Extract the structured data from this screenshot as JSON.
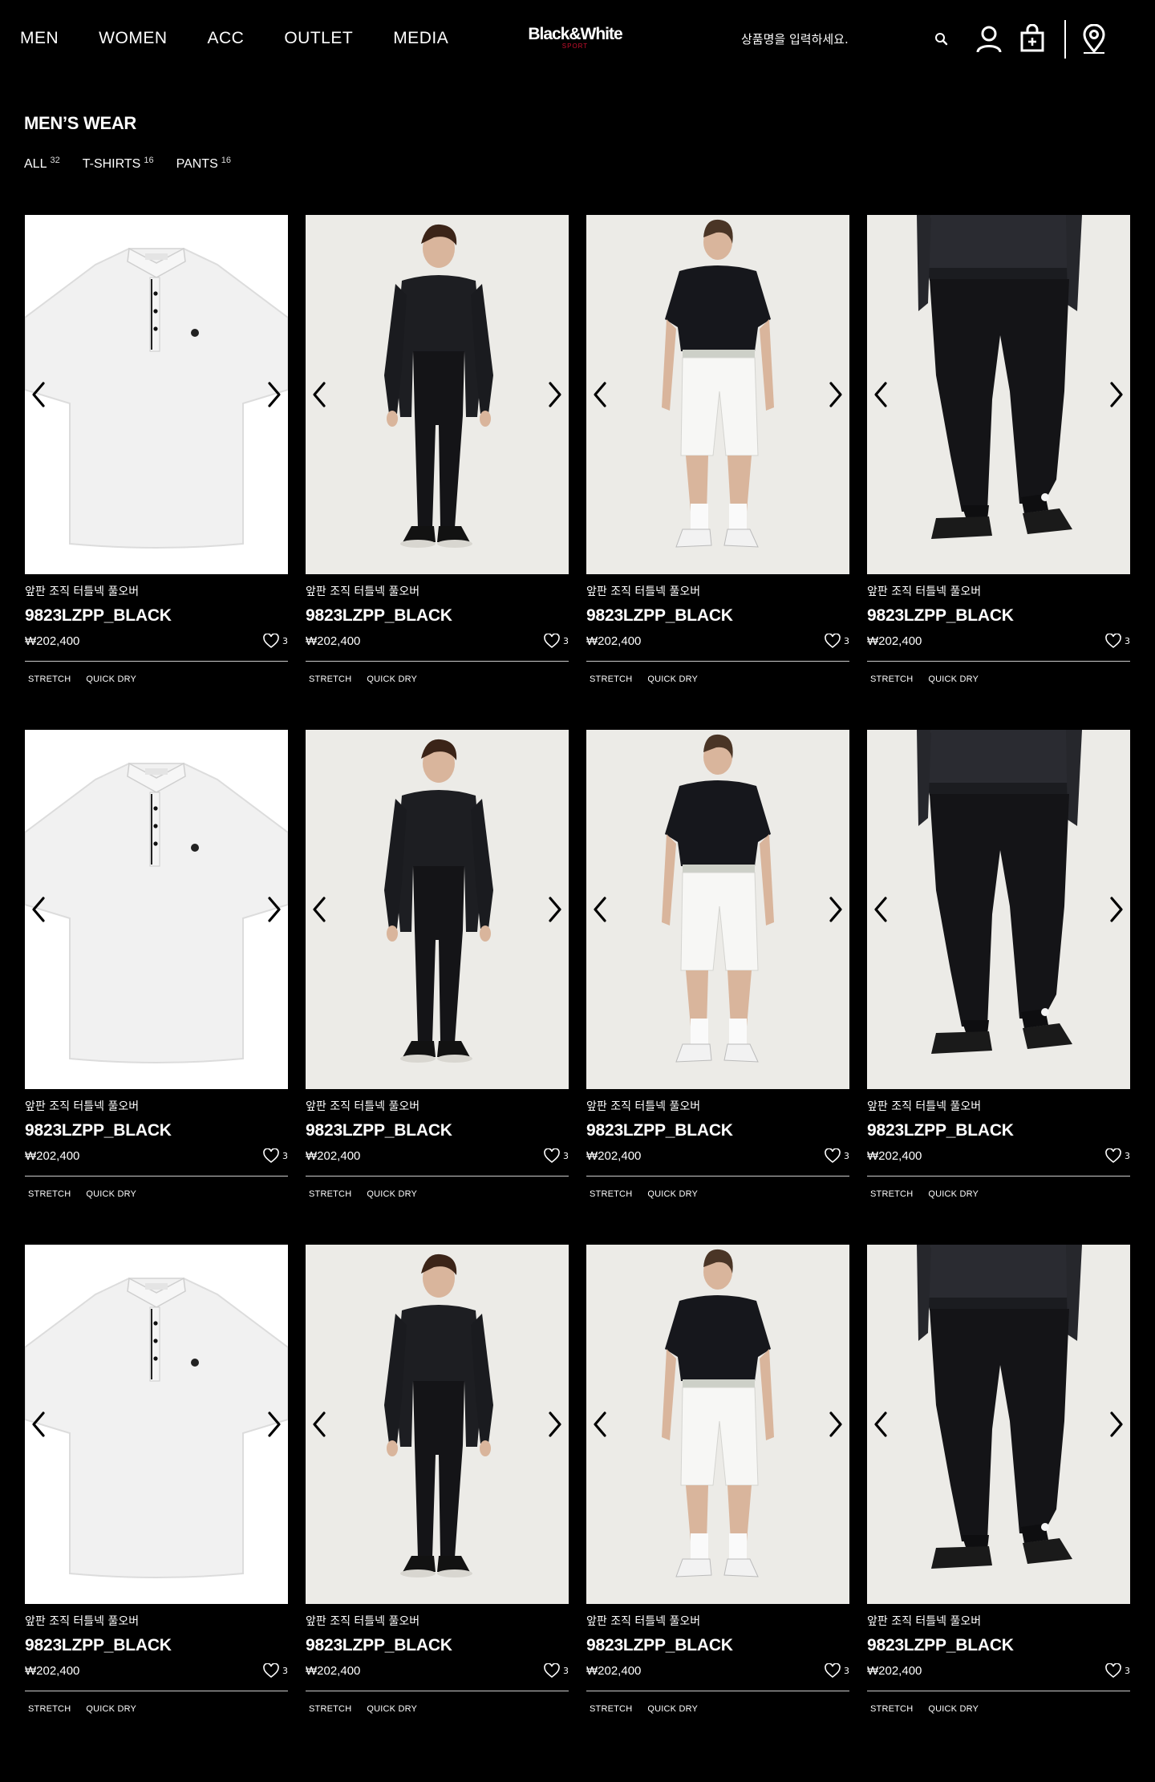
{
  "nav": [
    "MEN",
    "WOMEN",
    "ACC",
    "OUTLET",
    "MEDIA"
  ],
  "logo": {
    "main": "Black&White",
    "sub": "SPORT"
  },
  "search": {
    "placeholder": "상품명을 입력하세요."
  },
  "icons": [
    "search-icon",
    "user-icon",
    "shopping-bag-icon",
    "store-location-icon",
    "chevron-left-icon",
    "chevron-right-icon",
    "heart-icon"
  ],
  "colors": {
    "background": "#000000",
    "text": "#ffffff",
    "brand_accent": "#c8102e"
  },
  "page": {
    "title": "MEN’S WEAR",
    "filters": [
      {
        "label": "ALL",
        "count": "32"
      },
      {
        "label": "T-SHIRTS",
        "count": "16"
      },
      {
        "label": "PANTS",
        "count": "16"
      }
    ]
  },
  "products": [
    {
      "image": "white-polo-shirt",
      "subtitle": "앞판 조직 터틀넥 풀오버",
      "name": "9823LZPP_BLACK",
      "price": "₩202,400",
      "likes": "3",
      "tags": [
        "STRETCH",
        "QUICK DRY"
      ]
    },
    {
      "image": "model-black-longsleeve",
      "subtitle": "앞판 조직 터틀넥 풀오버",
      "name": "9823LZPP_BLACK",
      "price": "₩202,400",
      "likes": "3",
      "tags": [
        "STRETCH",
        "QUICK DRY"
      ]
    },
    {
      "image": "model-black-polo-white-shorts",
      "subtitle": "앞판 조직 터틀넥 풀오버",
      "name": "9823LZPP_BLACK",
      "price": "₩202,400",
      "likes": "3",
      "tags": [
        "STRETCH",
        "QUICK DRY"
      ]
    },
    {
      "image": "model-black-jogger-pants",
      "subtitle": "앞판 조직 터틀넥 풀오버",
      "name": "9823LZPP_BLACK",
      "price": "₩202,400",
      "likes": "3",
      "tags": [
        "STRETCH",
        "QUICK DRY"
      ]
    },
    {
      "image": "white-polo-shirt",
      "subtitle": "앞판 조직 터틀넥 풀오버",
      "name": "9823LZPP_BLACK",
      "price": "₩202,400",
      "likes": "3",
      "tags": [
        "STRETCH",
        "QUICK DRY"
      ]
    },
    {
      "image": "model-black-longsleeve",
      "subtitle": "앞판 조직 터틀넥 풀오버",
      "name": "9823LZPP_BLACK",
      "price": "₩202,400",
      "likes": "3",
      "tags": [
        "STRETCH",
        "QUICK DRY"
      ]
    },
    {
      "image": "model-black-polo-white-shorts",
      "subtitle": "앞판 조직 터틀넥 풀오버",
      "name": "9823LZPP_BLACK",
      "price": "₩202,400",
      "likes": "3",
      "tags": [
        "STRETCH",
        "QUICK DRY"
      ]
    },
    {
      "image": "model-black-jogger-pants",
      "subtitle": "앞판 조직 터틀넥 풀오버",
      "name": "9823LZPP_BLACK",
      "price": "₩202,400",
      "likes": "3",
      "tags": [
        "STRETCH",
        "QUICK DRY"
      ]
    },
    {
      "image": "white-polo-shirt",
      "subtitle": "앞판 조직 터틀넥 풀오버",
      "name": "9823LZPP_BLACK",
      "price": "₩202,400",
      "likes": "3",
      "tags": [
        "STRETCH",
        "QUICK DRY"
      ]
    },
    {
      "image": "model-black-longsleeve",
      "subtitle": "앞판 조직 터틀넥 풀오버",
      "name": "9823LZPP_BLACK",
      "price": "₩202,400",
      "likes": "3",
      "tags": [
        "STRETCH",
        "QUICK DRY"
      ]
    },
    {
      "image": "model-black-polo-white-shorts",
      "subtitle": "앞판 조직 터틀넥 풀오버",
      "name": "9823LZPP_BLACK",
      "price": "₩202,400",
      "likes": "3",
      "tags": [
        "STRETCH",
        "QUICK DRY"
      ]
    },
    {
      "image": "model-black-jogger-pants",
      "subtitle": "앞판 조직 터틀넥 풀오버",
      "name": "9823LZPP_BLACK",
      "price": "₩202,400",
      "likes": "3",
      "tags": [
        "STRETCH",
        "QUICK DRY"
      ]
    }
  ]
}
